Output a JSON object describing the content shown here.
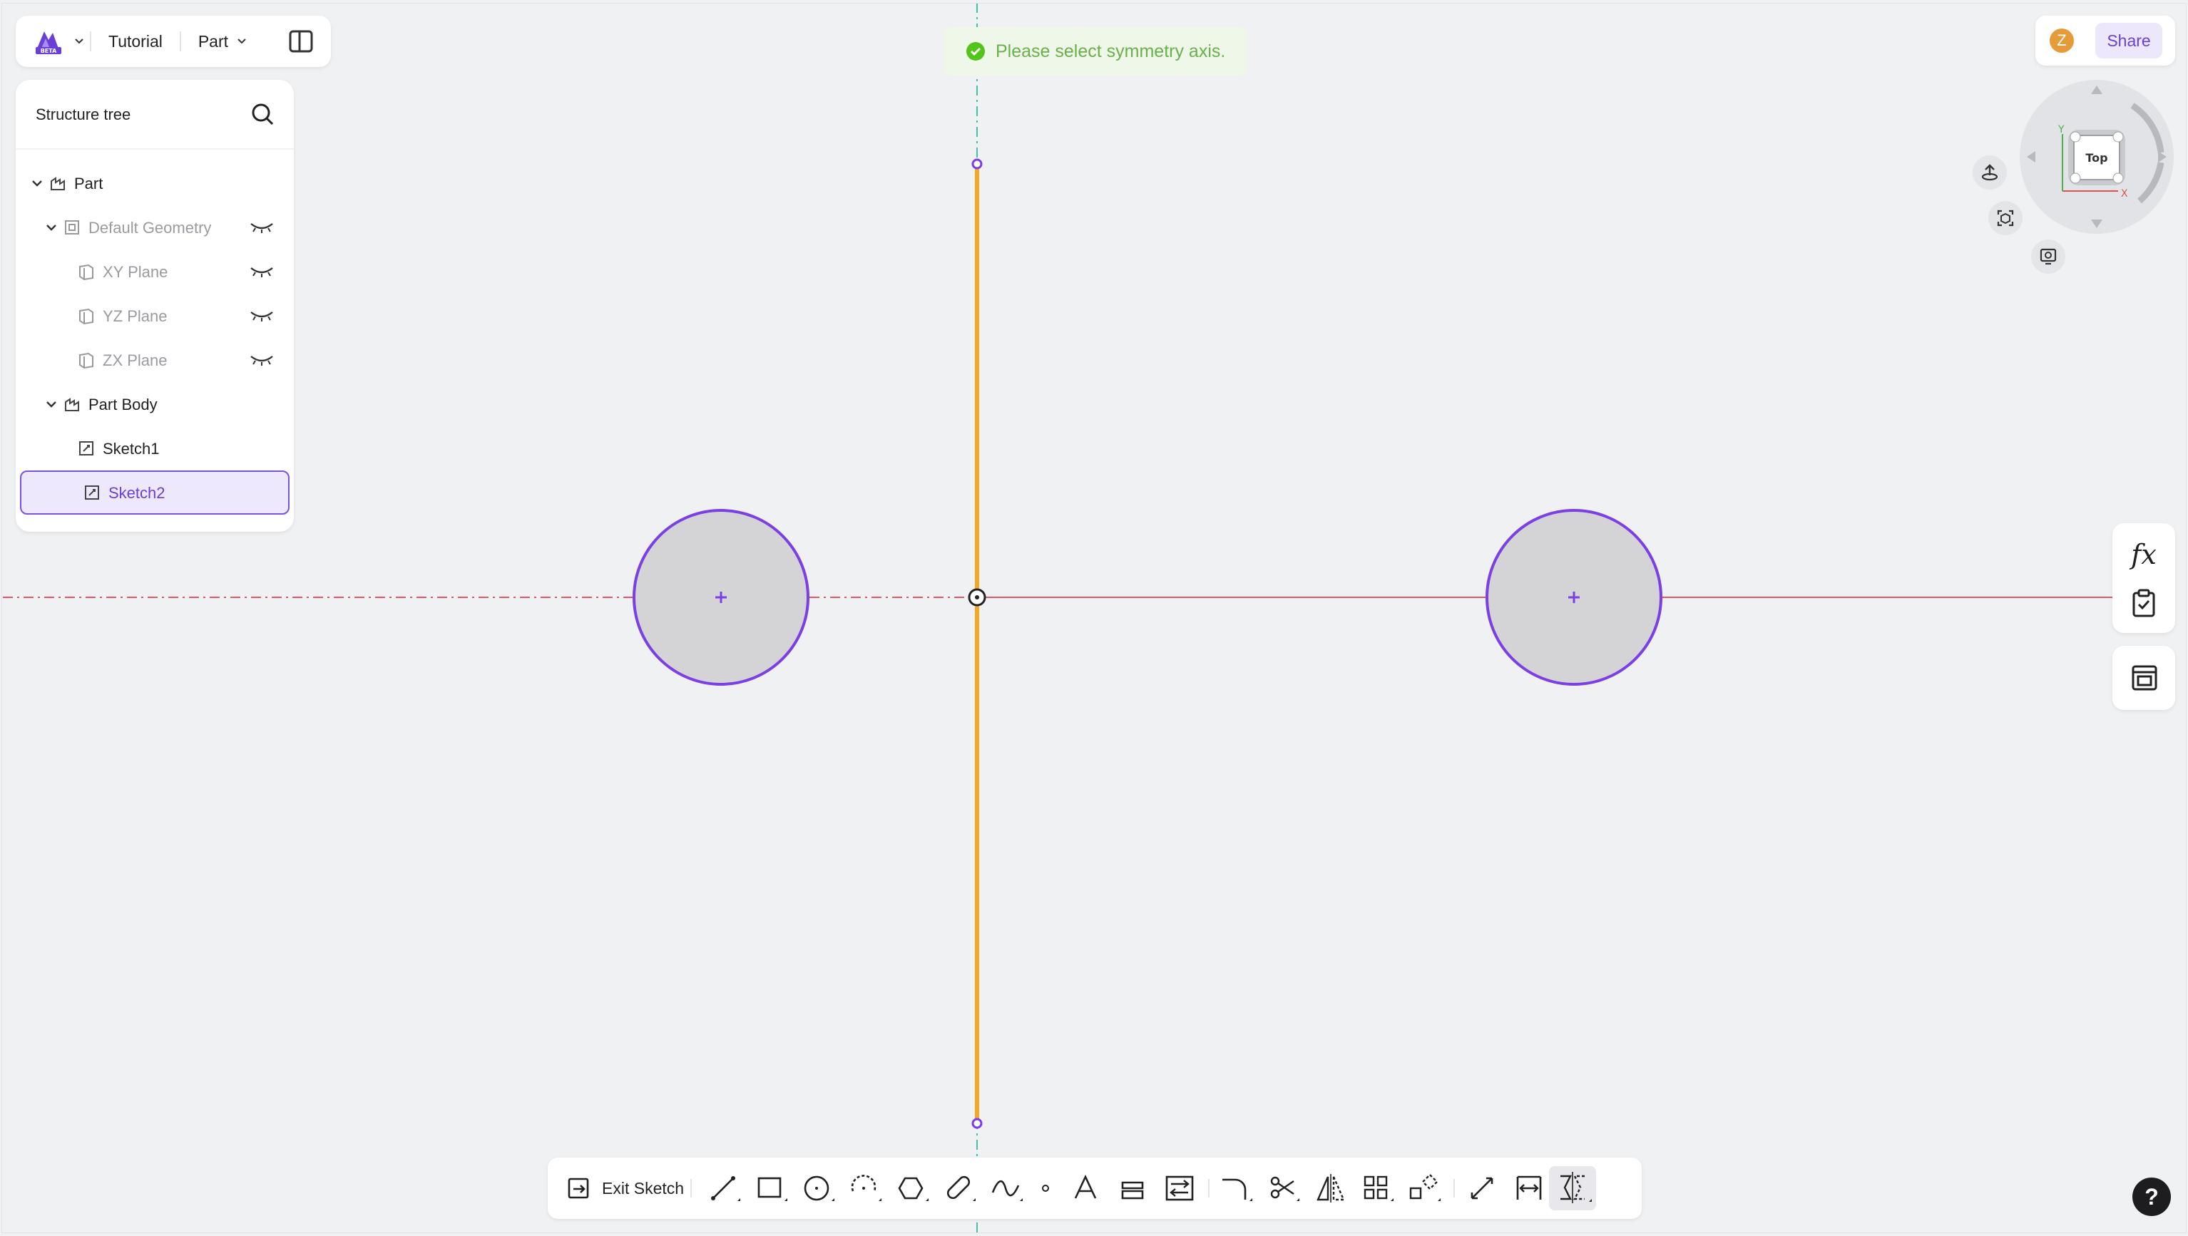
{
  "topbar": {
    "logo_badge": "BETA",
    "project": "Tutorial",
    "mode": "Part"
  },
  "tree": {
    "title": "Structure tree",
    "items": [
      {
        "label": "Part"
      },
      {
        "label": "Default Geometry"
      },
      {
        "label": "XY Plane"
      },
      {
        "label": "YZ Plane"
      },
      {
        "label": "ZX Plane"
      },
      {
        "label": "Part Body"
      },
      {
        "label": "Sketch1"
      },
      {
        "label": "Sketch2"
      }
    ]
  },
  "toast": {
    "message": "Please select symmetry axis."
  },
  "user": {
    "initial": "Z",
    "share_label": "Share"
  },
  "view_cube": {
    "face": "Top",
    "axis_x": "X",
    "axis_y": "Y"
  },
  "side_panel": {
    "fx_label": "fx"
  },
  "bottom_toolbar": {
    "exit_label": "Exit Sketch"
  },
  "help": {
    "label": "?"
  },
  "colors": {
    "accent": "#6a3fd8",
    "selected_line": "#f5a623",
    "circle_stroke": "#7b3fe4",
    "axis_h": "#e0566b",
    "axis_v": "#3fc0a8",
    "toast_text": "#6ab04c"
  }
}
